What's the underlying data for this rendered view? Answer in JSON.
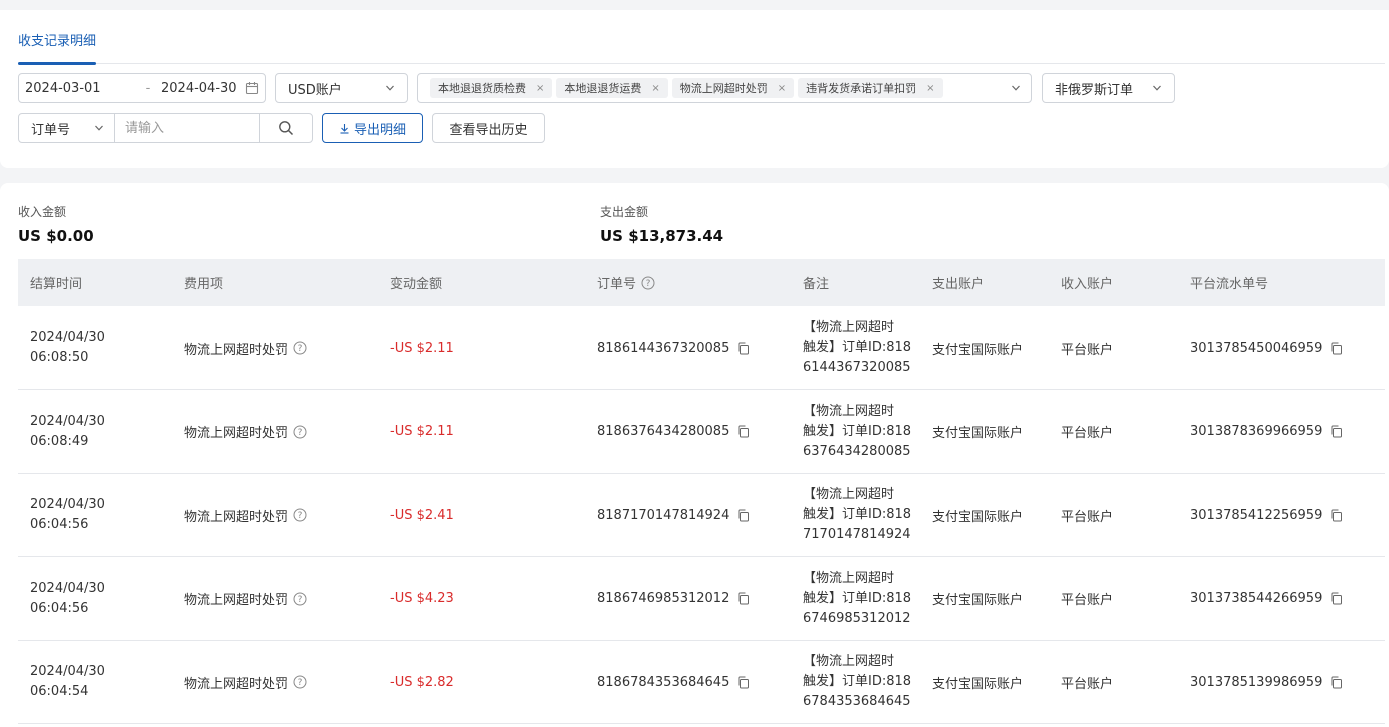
{
  "tabs": {
    "active": "收支记录明细"
  },
  "filters": {
    "date_start": "2024-03-01",
    "date_sep": "-",
    "date_end": "2024-04-30",
    "currency_account": "USD账户",
    "fee_tags": [
      "本地退退货质检费",
      "本地退退货运费",
      "物流上网超时处罚",
      "违背发货承诺订单扣罚"
    ],
    "region": "非俄罗斯订单",
    "search_type": "订单号",
    "search_placeholder": "请输入"
  },
  "buttons": {
    "export": "导出明细",
    "history": "查看导出历史"
  },
  "summary": {
    "income_label": "收入金额",
    "income_value": "US $0.00",
    "expense_label": "支出金额",
    "expense_value": "US $13,873.44"
  },
  "table": {
    "headers": {
      "settle_time": "结算时间",
      "fee_item": "费用项",
      "change_amount": "变动金额",
      "order_no": "订单号",
      "remark": "备注",
      "out_account": "支出账户",
      "in_account": "收入账户",
      "platform_serial": "平台流水单号"
    },
    "rows": [
      {
        "date": "2024/04/30",
        "time": "06:08:50",
        "fee": "物流上网超时处罚",
        "amount": "-US $2.11",
        "order": "8186144367320085",
        "remark": [
          "【物流上网超时",
          "触发】订单ID:818",
          "6144367320085"
        ],
        "out": "支付宝国际账户",
        "in": "平台账户",
        "serial": "3013785450046959"
      },
      {
        "date": "2024/04/30",
        "time": "06:08:49",
        "fee": "物流上网超时处罚",
        "amount": "-US $2.11",
        "order": "8186376434280085",
        "remark": [
          "【物流上网超时",
          "触发】订单ID:818",
          "6376434280085"
        ],
        "out": "支付宝国际账户",
        "in": "平台账户",
        "serial": "3013878369966959"
      },
      {
        "date": "2024/04/30",
        "time": "06:04:56",
        "fee": "物流上网超时处罚",
        "amount": "-US $2.41",
        "order": "8187170147814924",
        "remark": [
          "【物流上网超时",
          "触发】订单ID:818",
          "7170147814924"
        ],
        "out": "支付宝国际账户",
        "in": "平台账户",
        "serial": "3013785412256959"
      },
      {
        "date": "2024/04/30",
        "time": "06:04:56",
        "fee": "物流上网超时处罚",
        "amount": "-US $4.23",
        "order": "8186746985312012",
        "remark": [
          "【物流上网超时",
          "触发】订单ID:818",
          "6746985312012"
        ],
        "out": "支付宝国际账户",
        "in": "平台账户",
        "serial": "3013738544266959"
      },
      {
        "date": "2024/04/30",
        "time": "06:04:54",
        "fee": "物流上网超时处罚",
        "amount": "-US $2.82",
        "order": "8186784353684645",
        "remark": [
          "【物流上网超时",
          "触发】订单ID:818",
          "6784353684645"
        ],
        "out": "支付宝国际账户",
        "in": "平台账户",
        "serial": "3013785139986959"
      }
    ]
  },
  "colors": {
    "accent": "#1a5fb4",
    "negative": "#d92b2b"
  }
}
